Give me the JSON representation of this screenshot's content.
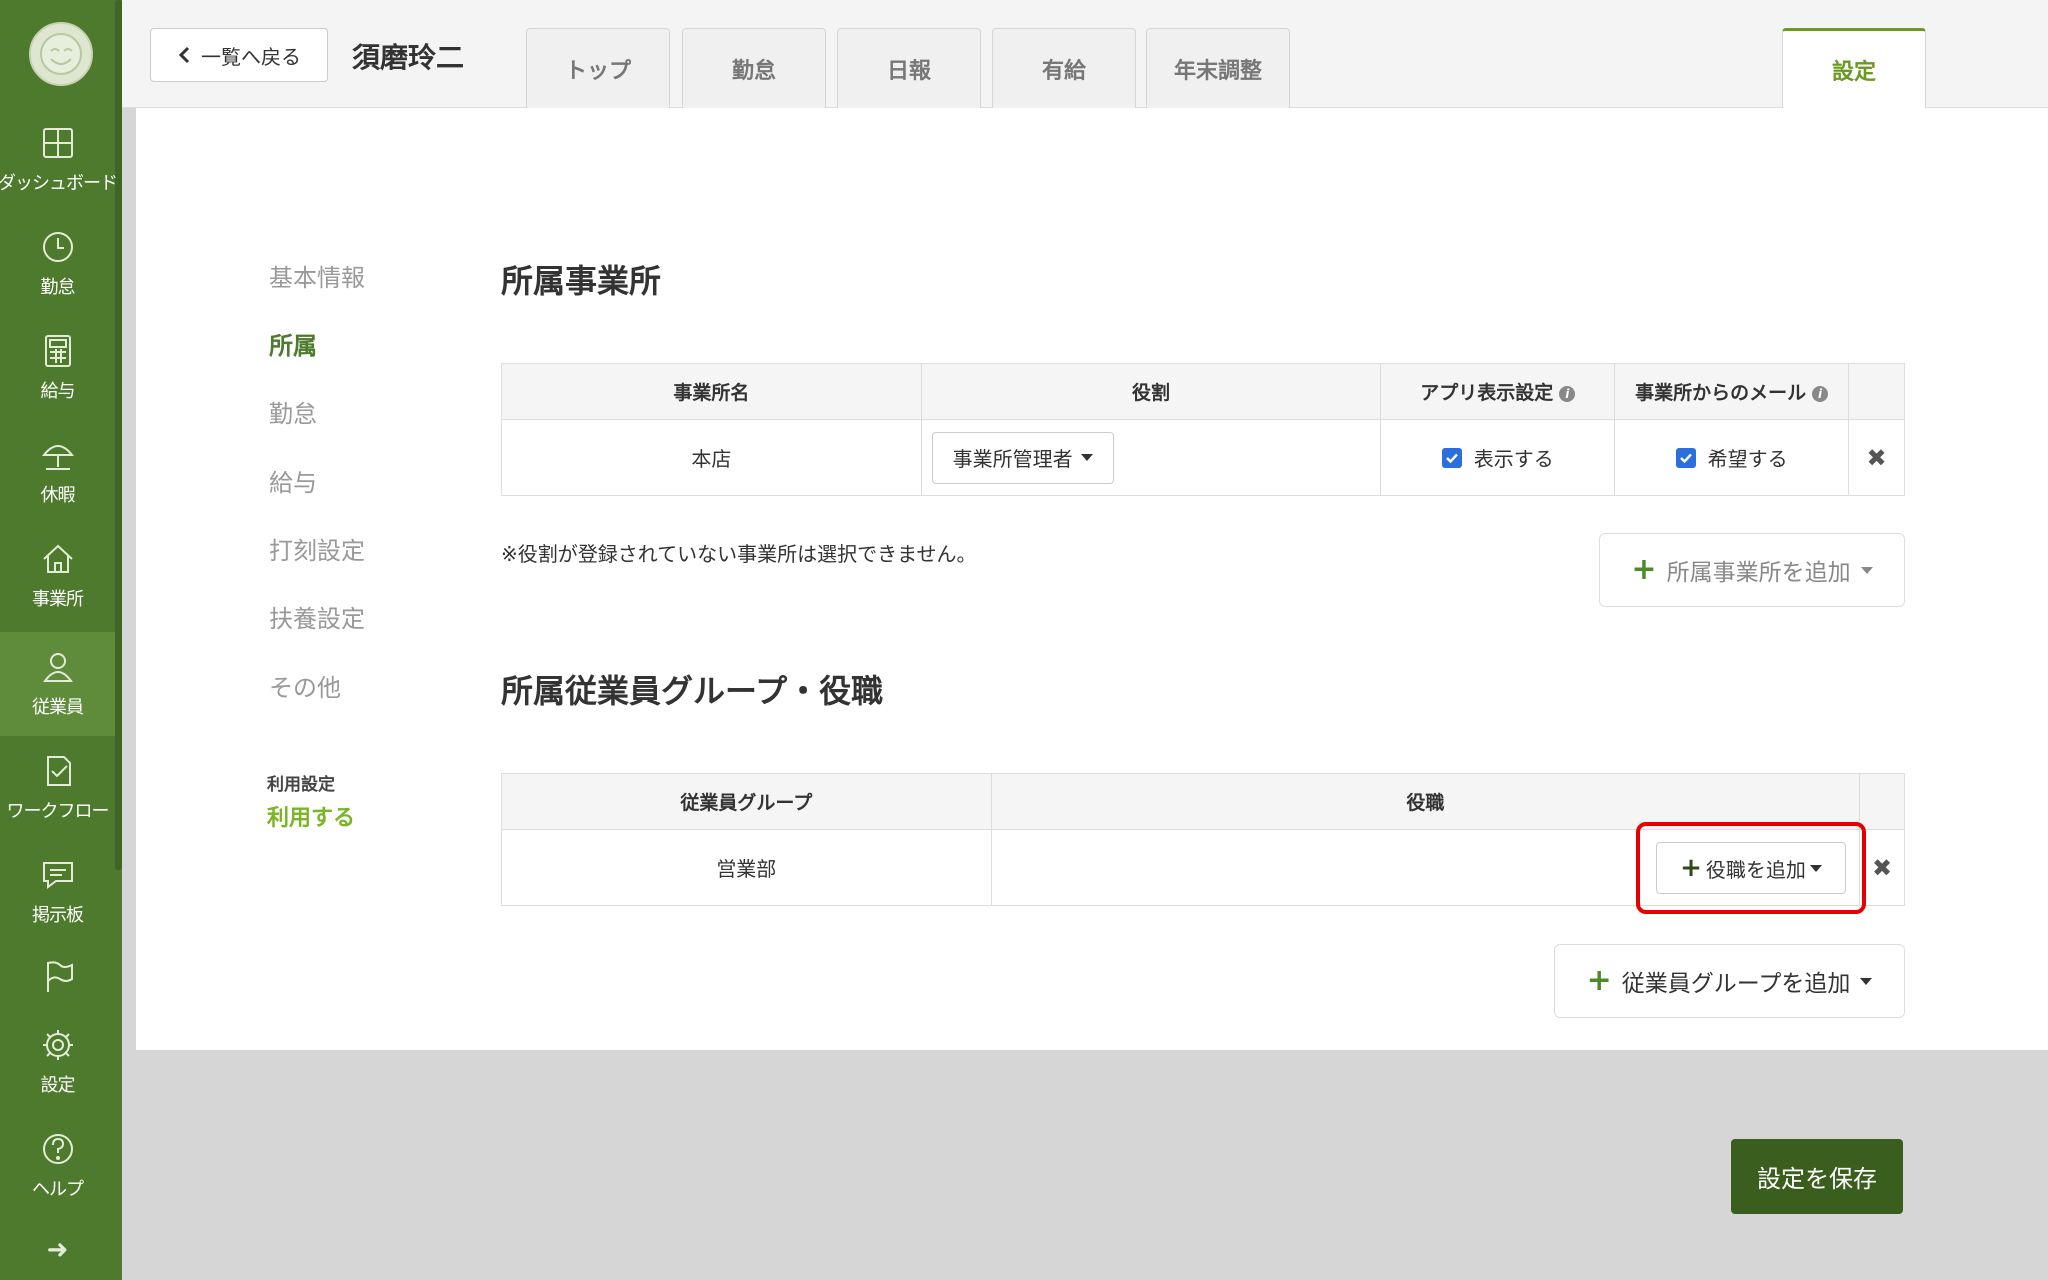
{
  "nav": {
    "items": [
      {
        "id": "dashboard",
        "label": "ダッシュボード"
      },
      {
        "id": "attendance",
        "label": "勤怠"
      },
      {
        "id": "payroll",
        "label": "給与"
      },
      {
        "id": "leave",
        "label": "休暇"
      },
      {
        "id": "office",
        "label": "事業所"
      },
      {
        "id": "employee",
        "label": "従業員"
      },
      {
        "id": "workflow",
        "label": "ワークフロー"
      },
      {
        "id": "board",
        "label": "掲示板"
      },
      {
        "id": "flag",
        "label": ""
      },
      {
        "id": "settings",
        "label": "設定"
      },
      {
        "id": "help",
        "label": "ヘルプ"
      }
    ],
    "active": "従業員"
  },
  "header": {
    "back_label": "一覧へ戻る",
    "employee_name": "須磨玲二",
    "tabs": [
      "トップ",
      "勤怠",
      "日報",
      "有給",
      "年末調整"
    ],
    "settings_tab": "設定"
  },
  "subnav": {
    "items": [
      "基本情報",
      "所属",
      "勤怠",
      "給与",
      "打刻設定",
      "扶養設定",
      "その他"
    ],
    "active": "所属",
    "usage_label": "利用設定",
    "usage_value": "利用する"
  },
  "offices": {
    "title": "所属事業所",
    "headers": [
      "事業所名",
      "役割",
      "アプリ表示設定",
      "事業所からのメール"
    ],
    "rows": [
      {
        "name": "本店",
        "role": "事業所管理者",
        "app_display": "表示する",
        "email": "希望する"
      }
    ],
    "note": "※役割が登録されていない事業所は選択できません。",
    "add_label": "所属事業所を追加"
  },
  "groups": {
    "title": "所属従業員グループ・役職",
    "headers": [
      "従業員グループ",
      "役職"
    ],
    "rows": [
      {
        "group": "営業部",
        "add_title_label": "役職を追加"
      }
    ],
    "add_label": "従業員グループを追加"
  },
  "save_label": "設定を保存",
  "colors": {
    "brand": "#4d7a2c",
    "accent": "#6a9a1f",
    "highlight": "#e60000",
    "checkbox": "#2a6fdb"
  }
}
